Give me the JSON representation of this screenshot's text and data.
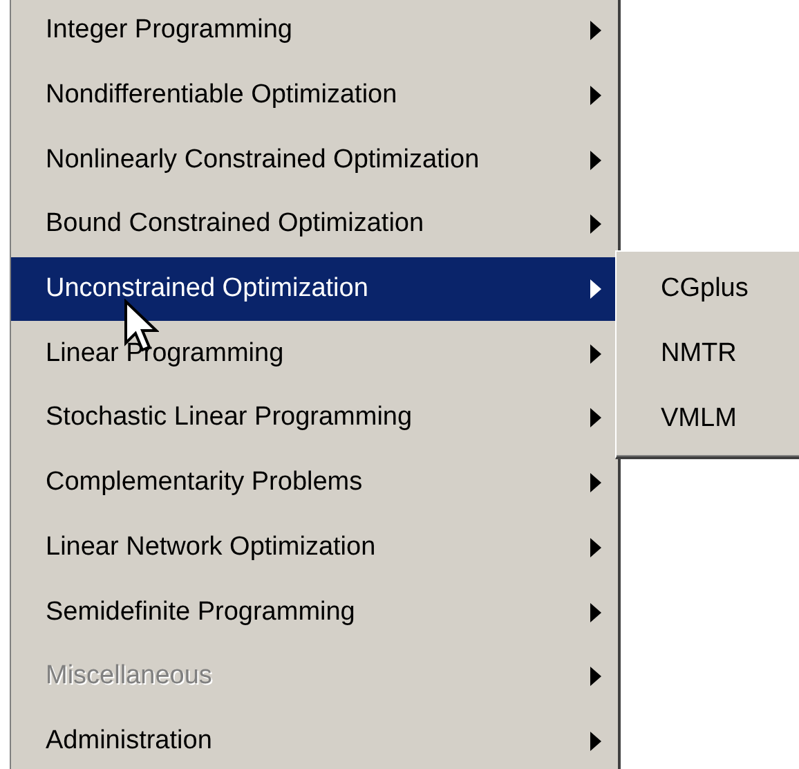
{
  "menu": {
    "items": [
      {
        "label": "Integer Programming",
        "selected": false,
        "disabled": false
      },
      {
        "label": "Nondifferentiable Optimization",
        "selected": false,
        "disabled": false
      },
      {
        "label": "Nonlinearly Constrained Optimization",
        "selected": false,
        "disabled": false
      },
      {
        "label": "Bound Constrained Optimization",
        "selected": false,
        "disabled": false
      },
      {
        "label": "Unconstrained Optimization",
        "selected": true,
        "disabled": false
      },
      {
        "label": "Linear Programming",
        "selected": false,
        "disabled": false
      },
      {
        "label": "Stochastic Linear Programming",
        "selected": false,
        "disabled": false
      },
      {
        "label": "Complementarity Problems",
        "selected": false,
        "disabled": false
      },
      {
        "label": "Linear Network Optimization",
        "selected": false,
        "disabled": false
      },
      {
        "label": "Semidefinite Programming",
        "selected": false,
        "disabled": false
      },
      {
        "label": "Miscellaneous",
        "selected": false,
        "disabled": true
      },
      {
        "label": "Administration",
        "selected": false,
        "disabled": false
      }
    ]
  },
  "submenu": {
    "items": [
      {
        "label": "CGplus",
        "selected": false
      },
      {
        "label": "NMTR",
        "selected": false
      },
      {
        "label": "VMLM",
        "selected": false
      }
    ]
  }
}
